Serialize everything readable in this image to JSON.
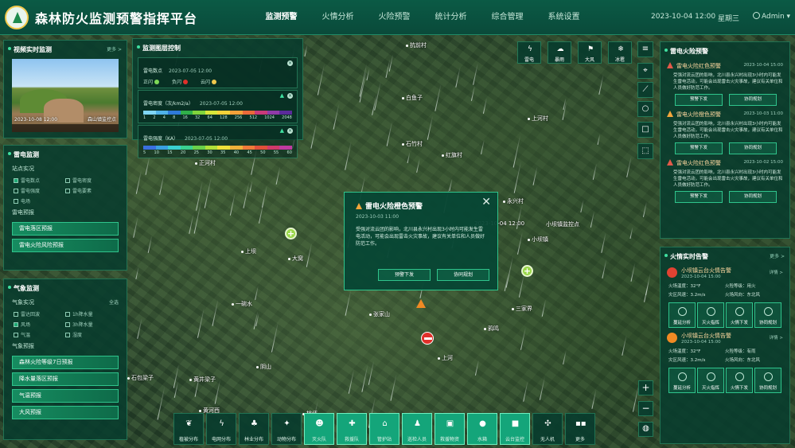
{
  "header": {
    "title": "森林防火监测预警指挥平台",
    "nav": [
      {
        "label": "监测预警",
        "active": true
      },
      {
        "label": "火情分析",
        "active": false
      },
      {
        "label": "火险预警",
        "active": false
      },
      {
        "label": "统计分析",
        "active": false
      },
      {
        "label": "综合管理",
        "active": false
      },
      {
        "label": "系统设置",
        "active": false
      }
    ],
    "datetime": "2023-10-04  12:00",
    "weekday": "星期三",
    "user": "Admin"
  },
  "video_panel": {
    "title": "视频实时监测",
    "more": "更多 >",
    "timestamp": "2023-10-08 12:00",
    "location": "森山镇监控点"
  },
  "thunder_panel": {
    "title": "雷电监测",
    "realtime_label": "站点实况",
    "checks": [
      "雷电数点",
      "雷电密度",
      "雷电强度",
      "雷电要素",
      "电场"
    ],
    "forecast_label": "雷电预报",
    "buttons": [
      "雷电落区预报",
      "雷电火险风险预报"
    ]
  },
  "weather_panel": {
    "title": "气象监测",
    "realtime_label": "气象实况",
    "toggle_label": "全选",
    "checks": [
      "雷达回波",
      "1h降水量",
      "风场",
      "3h降水量",
      "气温",
      "湿度"
    ],
    "forecast_label": "气象预报",
    "buttons": [
      "森林火险等级7日预报",
      "降水量落区预报",
      "气温预报",
      "大风预报"
    ]
  },
  "monitor_control": {
    "title": "监测图层控制",
    "rows": [
      {
        "label": "雷电数点",
        "time": "2023-07-05 12:00",
        "legend": [
          {
            "name": "正闪",
            "color": "#7ed957"
          },
          {
            "name": "负闪",
            "color": "#e0302a"
          },
          {
            "name": "云闪",
            "color": "#f2c94c"
          }
        ]
      },
      {
        "label": "雷电密度（次/km2/a）",
        "time": "2023-07-05 12:00",
        "scale": [
          "1",
          "2",
          "4",
          "8",
          "16",
          "32",
          "64",
          "128",
          "256",
          "512",
          "1024",
          "2048"
        ]
      },
      {
        "label": "雷电强度（KA）",
        "time": "2023-07-05 12:00",
        "scale": [
          "5",
          "10",
          "15",
          "20",
          "25",
          "30",
          "35",
          "40",
          "45",
          "50",
          "55",
          "60"
        ]
      }
    ]
  },
  "popup": {
    "title": "雷电火险橙色预警",
    "time": "2023-10-03 11:00",
    "text": "受强对流云团的影响，北川县永兴村出现3小时内可能发生雷电活动，可能会出现雷击火灾事故，建议有关单位和人员做好防范工作。",
    "btn_issue": "预警下发",
    "btn_plan": "协同规划"
  },
  "thunder_alerts": {
    "title": "雷电火险预警",
    "items": [
      {
        "head": "雷电火险红色预警",
        "level": "red",
        "time": "2023-10-04 15:00",
        "text": "受强对流云团的影响，北川县永兴村出现3小时内可能发生雷电活动，可能会出现雷击火灾事故，建议有关单位和人员做好防范工作。"
      },
      {
        "head": "雷电火险橙色预警",
        "level": "orange",
        "time": "2023-10-03 11:00",
        "text": "受强对流云团的影响，北川县永兴村出现3小时内可能发生雷电活动，可能会出现雷击火灾事故，建议有关单位和人员做好防范工作。"
      },
      {
        "head": "雷电火险红色预警",
        "level": "red",
        "time": "2023-10-02 15:00",
        "text": "受强对流云团的影响，北川县永兴村出现3小时内可能发生雷电活动，可能会出现雷击火灾事故，建议有关单位和人员做好防范工作。"
      }
    ],
    "btn_issue": "预警下发",
    "btn_plan": "协同规划"
  },
  "fire_reports": {
    "title": "火情实时告警",
    "more": "更多 >",
    "detail": "详情 >",
    "items": [
      {
        "head": "小坝镇云台火情告警",
        "time": "2023-10-04 15:00",
        "temp": "火场温度：32°F",
        "risk": "火险等级：用火",
        "area": "灾区风速：3.2m/s",
        "wind": "火场风向：东北风"
      },
      {
        "head": "小坝镇云台火情告警",
        "time": "2023-10-04 15:00",
        "temp": "火场温度：32°F",
        "risk": "火险等级：有雨",
        "area": "灾区风速：3.2m/s",
        "wind": "火场风向：东北风"
      }
    ],
    "actions": [
      "蔓延分析",
      "灭火指挥",
      "火情下发",
      "协同规划"
    ]
  },
  "weather_tools": [
    "雷电",
    "暴雨",
    "大风",
    "冰雹"
  ],
  "layers": [
    {
      "label": "植被分布",
      "icon": "❦",
      "active": false
    },
    {
      "label": "电网分布",
      "icon": "ϟ",
      "active": false
    },
    {
      "label": "林业分布",
      "icon": "♣",
      "active": false
    },
    {
      "label": "动物分布",
      "icon": "✦",
      "active": false
    },
    {
      "label": "灭火队",
      "icon": "☻",
      "active": true
    },
    {
      "label": "救援队",
      "icon": "✚",
      "active": true
    },
    {
      "label": "管护站",
      "icon": "⌂",
      "active": true
    },
    {
      "label": "巡检人员",
      "icon": "♟",
      "active": true
    },
    {
      "label": "救援物资",
      "icon": "▣",
      "active": true
    },
    {
      "label": "水箱",
      "icon": "●",
      "active": true
    },
    {
      "label": "云台监控",
      "icon": "■",
      "active": true
    },
    {
      "label": "无人机",
      "icon": "✣",
      "active": false
    },
    {
      "label": "更多",
      "icon": "▪▪",
      "active": false
    }
  ],
  "map_labels": [
    "抗前村",
    "白鱼子",
    "石竹村",
    "红旗村",
    "上河村",
    "正河村",
    "永兴村",
    "小坝镇监控点",
    "小坝镇",
    "大窝",
    "一碗水",
    "张家山",
    "三家界",
    "鸦鸣",
    "上河",
    "上坝",
    "阴山",
    "石包梁子",
    "黄井梁子",
    "黄河西",
    "桃坪"
  ],
  "map_marker_time": "2023-10-04 12:00"
}
